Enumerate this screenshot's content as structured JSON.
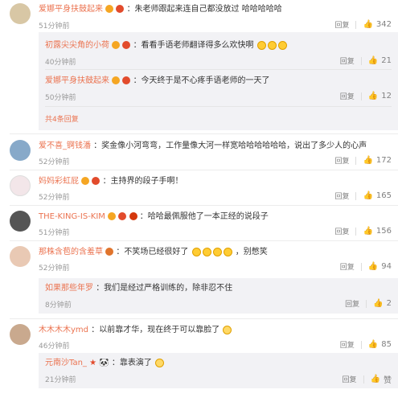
{
  "ui": {
    "reply": "回复"
  },
  "comments": [
    {
      "user": "爱娜平身扶鼓起来",
      "text": "：朱老师跟起来连自己都没放过 哈哈哈哈哈",
      "time": "51分钟前",
      "likes": "342",
      "replies": [
        {
          "user": "初露尖尖角的小荷",
          "text": "：看看手语老师翻译得多么欢快啊",
          "time": "40分钟前",
          "likes": "21"
        },
        {
          "user": "爱娜平身扶鼓起来",
          "text": "：今天终于是不心疼手语老师的一天了",
          "time": "50分钟前",
          "likes": "12"
        }
      ],
      "more": "共4条回复"
    },
    {
      "user": "爱不喜_锕钱潘",
      "text": "：奖金像小河弯弯，工作量像大河一样宽哈哈哈哈哈哈，说出了多少人的心声",
      "time": "52分钟前",
      "likes": "172"
    },
    {
      "user": "妈妈彩虹屁",
      "text": "：主持界的段子手啊！",
      "time": "52分钟前",
      "likes": "165"
    },
    {
      "user": "THE-KING-IS-KIM",
      "text": "：哈哈最佩服他了一本正经的说段子",
      "time": "51分钟前",
      "likes": "156"
    },
    {
      "user": "那株含苞的含羞草",
      "text": "：不笑场已经很好了",
      "text2": "，别憋笑",
      "time": "52分钟前",
      "likes": "94",
      "replies": [
        {
          "user": "如果那些年罗",
          "text": "：我们是经过严格训练的，除非忍不住",
          "time": "8分钟前",
          "likes": "2"
        }
      ]
    },
    {
      "user": "木木木木ymd",
      "text": "：以前靠才华，现在终于可以靠脸了",
      "time": "46分钟前",
      "likes": "85",
      "replies": [
        {
          "user": "元南沙Tan_",
          "text": "：靠表演了",
          "time": "21分钟前",
          "likes": "赞"
        }
      ]
    }
  ]
}
